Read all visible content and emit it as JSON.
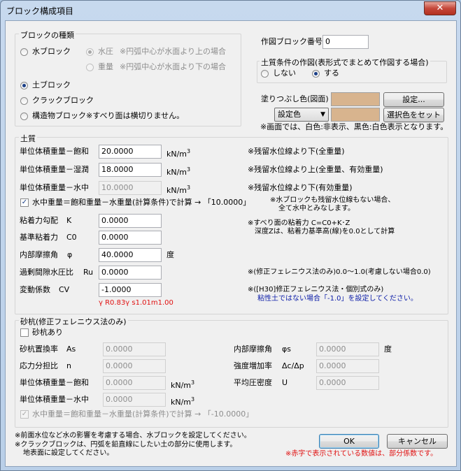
{
  "window": {
    "title": "ブロック構成項目",
    "close_glyph": "✕"
  },
  "block_type": {
    "legend": "ブロックの種類",
    "water_block": "水ブロック",
    "water_pressure_label": "水圧",
    "water_pressure_desc": "※円弧中心が水面より上の場合",
    "weight_label": "重量",
    "weight_desc": "※円弧中心が水面より下の場合",
    "soil_block": "土ブロック",
    "crack_block": "クラックブロック",
    "structure_block": "構造物ブロック",
    "structure_note": "※すべり面は横切りません。",
    "selected": "土ブロック"
  },
  "drawing": {
    "block_no_label": "作図ブロック番号",
    "block_no_value": "0",
    "soil_cond_legend": "土質条件の作図(表形式でまとめて作図する場合)",
    "no_label": "しない",
    "yes_label": "する",
    "selected": "する",
    "fill_label": "塗りつぶし色(図面)",
    "fill_color": "#d8b48e",
    "setting_button": "設定...",
    "color_combo": "設定色",
    "combo_arrow": "▼",
    "select_color_button": "選択色をセット",
    "screen_note": "※画面では、白色:非表示、黒色:白色表示となります。"
  },
  "soil": {
    "legend": "土質",
    "unit": "kN/m",
    "unit_exp": "3",
    "rows": [
      {
        "label": "単位体積重量－飽和",
        "value": "20.0000",
        "note": "※残留水位線より下(全重量)"
      },
      {
        "label": "単位体積重量－湿潤",
        "value": "18.0000",
        "note": "※残留水位線より上(全重量、有効重量)"
      },
      {
        "label": "単位体積重量－水中",
        "value": "10.0000",
        "note": "※残留水位線より下(有効重量)"
      }
    ],
    "calc_checkbox": "水中重量＝飽和重量－水重量(計算条件)で計算 → 「10.0000」",
    "calc_note_1": "※水ブロックも残留水位線もない場合、",
    "calc_note_2": "全て水中とみなします。",
    "adhesion_grad_label": "粘着力勾配",
    "adhesion_grad_symbol": "K",
    "adhesion_grad_value": "0.0000",
    "base_adhesion_label": "基準粘着力",
    "base_adhesion_symbol": "C0",
    "base_adhesion_value": "0.0000",
    "adhesion_note_1": "※すべり面の粘着力 C=C0+K･Z",
    "adhesion_note_2": "深度Zは、粘着力基準高(線)を0.0として計算",
    "friction_label": "内部摩擦角",
    "friction_symbol": "φ",
    "friction_value": "40.0000",
    "friction_unit": "度",
    "ru_label": "過剰間隙水圧比",
    "ru_symbol": "Ru",
    "ru_value": "0.0000",
    "ru_note": "※(修正フェレニウス法のみ)0.0～1.0(考慮しない場合0.0)",
    "cv_label": "変動係数",
    "cv_symbol": "CV",
    "cv_value": "-1.0000",
    "cv_note": "※([H30]修正フェレニウス法・個別式のみ)",
    "cv_blue_note": "粘性土ではない場合「-1.0」を設定してください。",
    "partial_factors": "γ R0.83γ s1.01m1.00",
    "red_color": "#e01010",
    "blue_color": "#0b1ca8"
  },
  "sand_pile": {
    "legend": "砂杭(修正フェレニウス法のみ)",
    "enable_checkbox": "砂杭あり",
    "replace_ratio_label": "砂杭置換率",
    "replace_ratio_symbol": "As",
    "replace_ratio_value": "0.0000",
    "stress_share_label": "応力分担比",
    "stress_share_symbol": "n",
    "stress_share_value": "0.0000",
    "sat_weight_label": "単位体積重量－飽和",
    "sat_weight_value": "0.0000",
    "sub_weight_label": "単位体積重量－水中",
    "sub_weight_value": "0.0000",
    "friction_label": "内部摩擦角",
    "friction_symbol": "φs",
    "friction_value": "0.0000",
    "friction_unit": "度",
    "strength_label": "強度増加率",
    "strength_symbol": "Δc/Δp",
    "strength_value": "0.0000",
    "density_label": "平均圧密度",
    "density_symbol": "U",
    "density_value": "0.0000",
    "unit": "kN/m",
    "unit_exp": "3",
    "calc_checkbox": "水中重量＝飽和重量－水重量(計算条件)で計算 → 「-10.0000」"
  },
  "footer": {
    "note_1": "※前面水位など水の影響を考慮する場合、水ブロックを設定してください。",
    "note_2": "※クラックブロックは、円弧を鉛直線にしたい土の部分に使用します。",
    "note_3": "地表面に設定してください。",
    "ok_button": "OK",
    "cancel_button": "キャンセル",
    "red_note": "※赤字で表示されている数値は、部分係数です。"
  }
}
